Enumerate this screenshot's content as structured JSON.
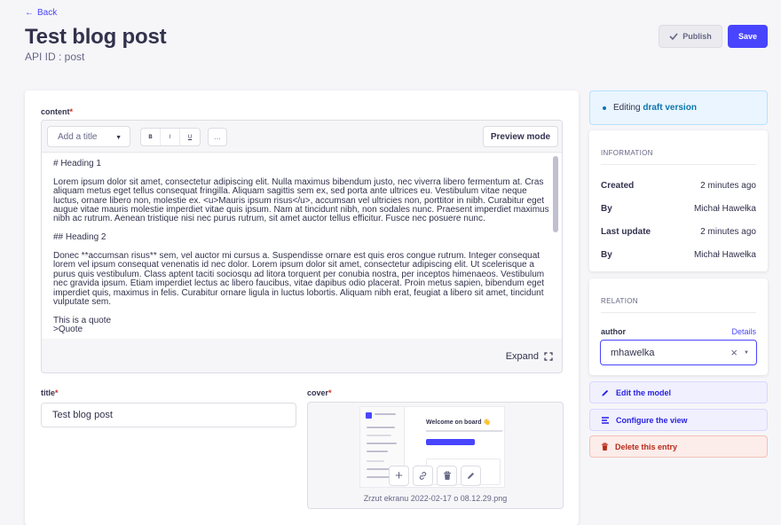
{
  "header": {
    "back_label": "Back",
    "title": "Test blog post",
    "api_id": "API ID : post",
    "publish_label": "Publish",
    "save_label": "Save"
  },
  "editor": {
    "field_label": "content",
    "required_mark": "*",
    "heading_select": "Add a title",
    "format_buttons": [
      "B",
      "I",
      "U"
    ],
    "more_label": "…",
    "preview_label": "Preview mode",
    "content": "# Heading 1\n\nLorem ipsum dolor sit amet, consectetur adipiscing elit. Nulla maximus bibendum justo, nec viverra libero fermentum at. Cras aliquam metus eget tellus consequat fringilla. Aliquam sagittis sem ex, sed porta ante ultrices eu. Vestibulum vitae neque luctus, ornare libero non, molestie ex. <u>Mauris ipsum risus</u>, accumsan vel ultricies non, porttitor in nibh. Curabitur eget augue vitae mauris molestie imperdiet vitae quis ipsum. Nam at tincidunt nibh, non sodales nunc. Praesent imperdiet maximus nibh ac rutrum. Aenean tristique nisi nec purus rutrum, sit amet auctor tellus efficitur. Fusce nec posuere nunc.\n\n## Heading 2\n\nDonec **accumsan risus** sem, vel auctor mi cursus a. Suspendisse ornare est quis eros congue rutrum. Integer consequat lorem vel ipsum consequat venenatis id nec dolor. Lorem ipsum dolor sit amet, consectetur adipiscing elit. Ut scelerisque a purus quis vestibulum. Class aptent taciti sociosqu ad litora torquent per conubia nostra, per inceptos himenaeos. Vestibulum nec gravida ipsum. Etiam imperdiet lectus ac libero faucibus, vitae dapibus odio placerat. Proin metus sapien, bibendum eget imperdiet quis, maximus in felis. Curabitur ornare ligula in luctus lobortis. Aliquam nibh erat, feugiat a libero sit amet, tincidunt vulputate sem.\n\nThis is a quote\n>Quote",
    "expand_label": "Expand"
  },
  "title_field": {
    "label": "title",
    "required_mark": "*",
    "value": "Test blog post"
  },
  "cover_field": {
    "label": "cover",
    "required_mark": "*",
    "thumbnail_heading": "Welcome on board 👋",
    "filename": "Zrzut ekranu 2022-02-17 o 08.12.29.png"
  },
  "draft_notice": {
    "prefix": "Editing",
    "emphasis": "draft version"
  },
  "information": {
    "heading": "INFORMATION",
    "rows": [
      {
        "label": "Created",
        "value": "2 minutes ago"
      },
      {
        "label": "By",
        "value": "Michał Hawełka"
      },
      {
        "label": "Last update",
        "value": "2 minutes ago"
      },
      {
        "label": "By",
        "value": "Michał Hawełka"
      }
    ]
  },
  "relation": {
    "heading": "RELATION",
    "field_label": "author",
    "details_label": "Details",
    "value": "mhawelka"
  },
  "actions": {
    "edit_model": "Edit the model",
    "configure_view": "Configure the view",
    "delete_entry": "Delete this entry"
  },
  "colors": {
    "primary": "#4945ff",
    "danger": "#d02b20",
    "background": "#f6f6f9",
    "info": "#0c75af"
  }
}
